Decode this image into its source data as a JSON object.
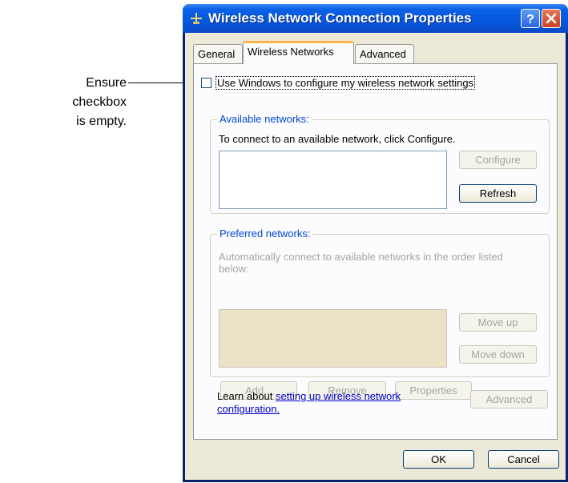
{
  "callout": {
    "line1": "Ensure checkbox",
    "line2": "is empty."
  },
  "window": {
    "title": "Wireless Network Connection Properties"
  },
  "tabs": {
    "general": "General",
    "wireless": "Wireless Networks",
    "advanced": "Advanced"
  },
  "checkbox": {
    "label": "Use Windows to configure my wireless network settings",
    "checked": false
  },
  "available": {
    "legend": "Available networks:",
    "instruction": "To connect to an available network, click Configure.",
    "configure_label": "Configure",
    "refresh_label": "Refresh"
  },
  "preferred": {
    "legend": "Preferred networks:",
    "instruction_line1": "Automatically connect to available networks in the order listed",
    "instruction_line2": "below:",
    "move_up_label": "Move up",
    "move_down_label": "Move down",
    "add_label": "Add...",
    "remove_label": "Remove",
    "properties_label": "Properties"
  },
  "learn": {
    "prefix": "Learn about ",
    "link_line1": "setting up wireless network",
    "link_line2": "configuration."
  },
  "advanced_label": "Advanced",
  "ok_label": "OK",
  "cancel_label": "Cancel"
}
